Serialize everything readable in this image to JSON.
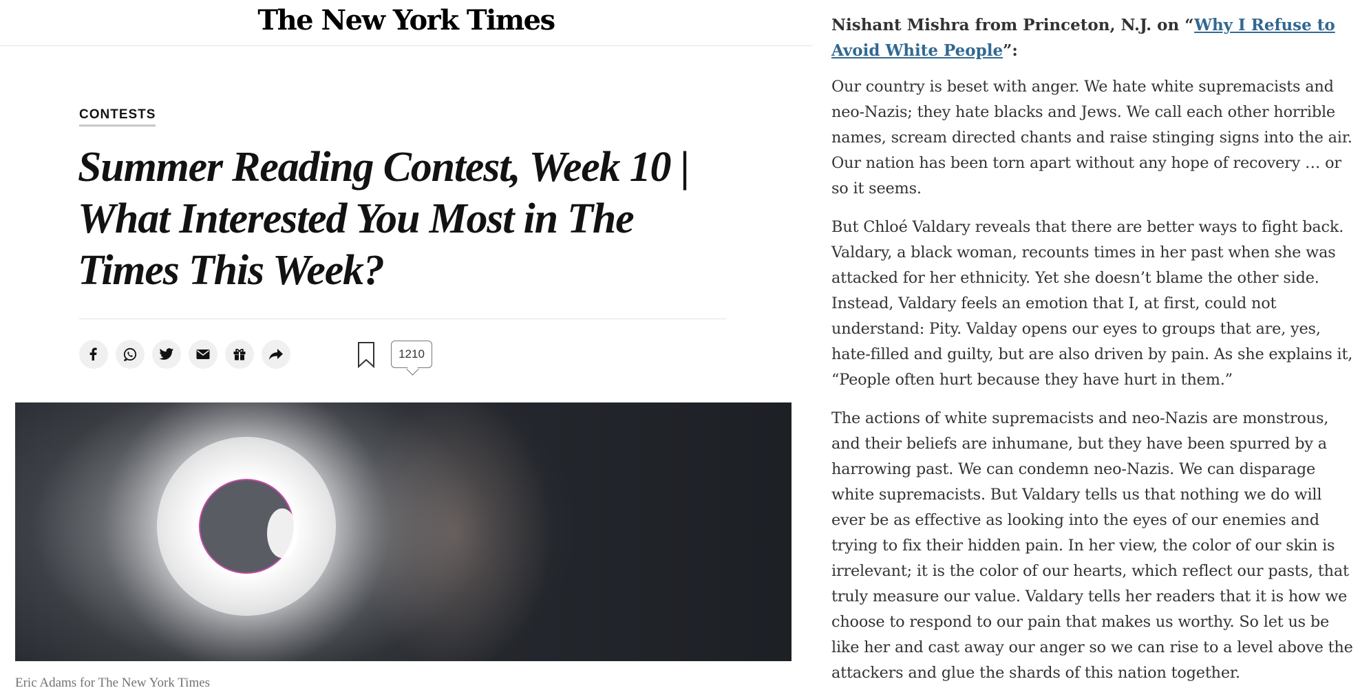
{
  "masthead": {
    "logo_text": "The New York Times"
  },
  "article": {
    "kicker": "CONTESTS",
    "headline_lines": [
      "Summer Reading Contest, Week 10 |",
      "What Interested You Most in The",
      "Times This Week?"
    ],
    "share_buttons": [
      {
        "name": "facebook-icon",
        "glyph": "f"
      },
      {
        "name": "whatsapp-icon",
        "glyph": "whatsapp"
      },
      {
        "name": "twitter-icon",
        "glyph": "twitter"
      },
      {
        "name": "email-icon",
        "glyph": "mail"
      },
      {
        "name": "gift-icon",
        "glyph": "gift"
      },
      {
        "name": "share-icon",
        "glyph": "share"
      }
    ],
    "comment_count": "1210",
    "hero_caption": "Eric Adams for The New York Times"
  },
  "comment": {
    "author": "Nishant Mishra from Princeton, N.J. on ",
    "open_quote": "“",
    "link_text": "Why I Refuse to Avoid White People",
    "close_quote": "”:",
    "paragraphs": [
      "Our country is beset with anger. We hate white supremacists and neo-Nazis; they hate blacks and Jews. We call each other horrible names, scream directed chants and raise stinging signs into the air. Our nation has been torn apart without any hope of recovery … or so it seems.",
      "But Chloé Valdary reveals that there are better ways to fight back. Valdary, a black woman, recounts times in her past when she was attacked for her ethnicity. Yet she doesn’t blame the other side. Instead, Valdary feels an emotion that I, at first, could not understand: Pity. Valday opens our eyes to groups that are, yes, hate-filled and guilty, but are also driven by pain. As she explains it, “People often hurt because they have hurt in them.”",
      "The actions of white supremacists and neo-Nazis are monstrous, and their beliefs are inhumane, but they have been spurred by a harrowing past. We can condemn neo-Nazis. We can disparage white supremacists. But Valdary tells us that nothing we do will ever be as effective as looking into the eyes of our enemies and trying to fix their hidden pain. In her view, the color of our skin is irrelevant; it is the color of our hearts, which reflect our pasts, that truly measure our value. Valdary tells her readers that it is how we choose to respond to our pain that makes us worthy. So let us be like her and cast away our anger so we can rise to a level above the attackers and glue the shards of this nation together."
    ]
  },
  "colors": {
    "link": "#326891",
    "text": "#333333",
    "caption": "#727272"
  }
}
